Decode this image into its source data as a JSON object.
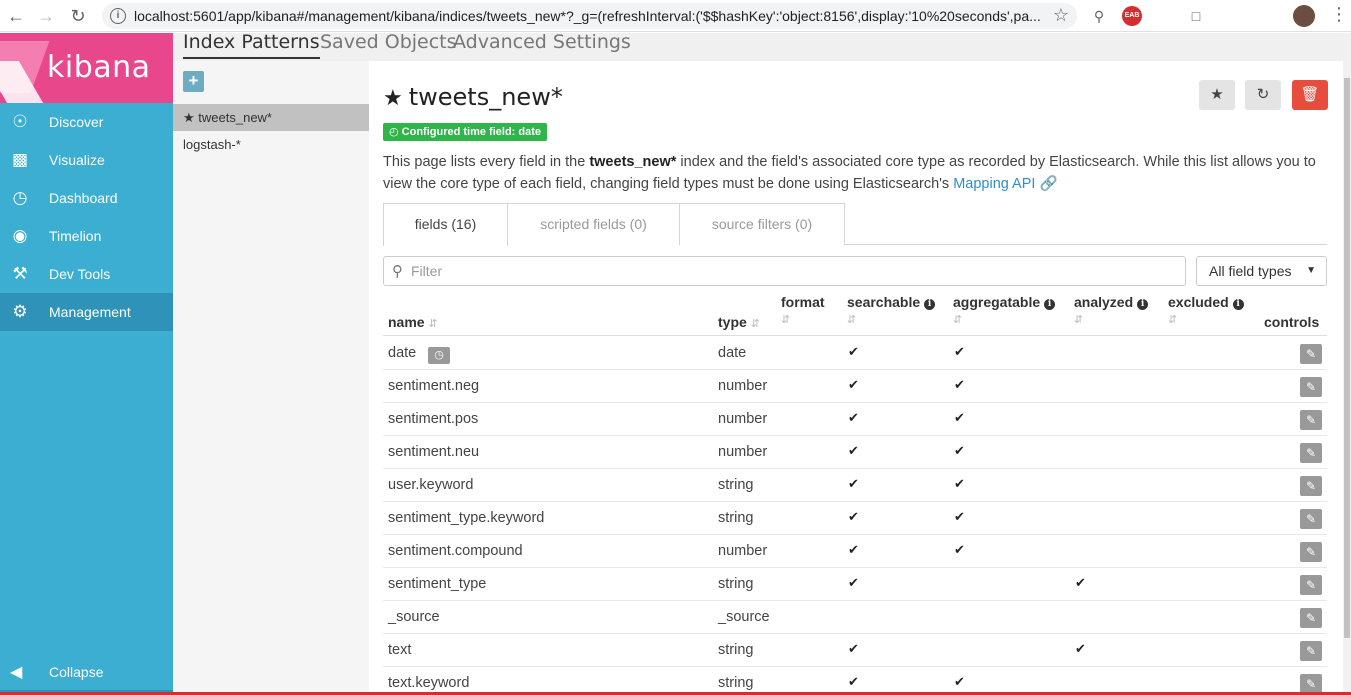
{
  "browser": {
    "url": "localhost:5601/app/kibana#/management/kibana/indices/tweets_new*?_g=(refreshInterval:('$$hashKey':'object:8156',display:'10%20seconds',pa...",
    "back_icon": "arrow-left",
    "forward_icon": "arrow-right",
    "reload_icon": "reload",
    "ext_badge": "EAB"
  },
  "sidebar": {
    "logo": "kibana",
    "items": [
      {
        "label": "Discover",
        "icon": "compass"
      },
      {
        "label": "Visualize",
        "icon": "bar-chart"
      },
      {
        "label": "Dashboard",
        "icon": "gauge"
      },
      {
        "label": "Timelion",
        "icon": "bear"
      },
      {
        "label": "Dev Tools",
        "icon": "wrench"
      },
      {
        "label": "Management",
        "icon": "gear"
      }
    ],
    "active": "Management",
    "collapse_label": "Collapse"
  },
  "topnav": {
    "tabs": [
      "Index Patterns",
      "Saved Objects",
      "Advanced Settings"
    ],
    "active": "Index Patterns"
  },
  "patterns": {
    "add_label": "+",
    "items": [
      "tweets_new*",
      "logstash-*"
    ],
    "selected": "tweets_new*"
  },
  "main": {
    "title": "tweets_new*",
    "time_badge": "Configured time field: date",
    "desc_1": "This page lists every field in the ",
    "desc_index": "tweets_new*",
    "desc_2": " index and the field's associated core type as recorded by Elasticsearch. While this list allows you to view the core type of each field, changing field types must be done using Elasticsearch's ",
    "desc_link": "Mapping API",
    "tabs": [
      "fields (16)",
      "scripted fields (0)",
      "source filters (0)"
    ],
    "filter_placeholder": "Filter",
    "type_select": "All field types"
  },
  "table": {
    "headers": {
      "name": "name",
      "type": "type",
      "format": "format",
      "searchable": "searchable",
      "aggregatable": "aggregatable",
      "analyzed": "analyzed",
      "excluded": "excluded",
      "controls": "controls"
    },
    "rows": [
      {
        "name": "date",
        "type": "date",
        "searchable": true,
        "aggregatable": true,
        "analyzed": false,
        "time": true
      },
      {
        "name": "sentiment.neg",
        "type": "number",
        "searchable": true,
        "aggregatable": true,
        "analyzed": false
      },
      {
        "name": "sentiment.pos",
        "type": "number",
        "searchable": true,
        "aggregatable": true,
        "analyzed": false
      },
      {
        "name": "sentiment.neu",
        "type": "number",
        "searchable": true,
        "aggregatable": true,
        "analyzed": false
      },
      {
        "name": "user.keyword",
        "type": "string",
        "searchable": true,
        "aggregatable": true,
        "analyzed": false
      },
      {
        "name": "sentiment_type.keyword",
        "type": "string",
        "searchable": true,
        "aggregatable": true,
        "analyzed": false
      },
      {
        "name": "sentiment.compound",
        "type": "number",
        "searchable": true,
        "aggregatable": true,
        "analyzed": false
      },
      {
        "name": "sentiment_type",
        "type": "string",
        "searchable": true,
        "aggregatable": false,
        "analyzed": true
      },
      {
        "name": "_source",
        "type": "_source",
        "searchable": false,
        "aggregatable": false,
        "analyzed": false
      },
      {
        "name": "text",
        "type": "string",
        "searchable": true,
        "aggregatable": false,
        "analyzed": true
      },
      {
        "name": "text.keyword",
        "type": "string",
        "searchable": true,
        "aggregatable": true,
        "analyzed": false
      }
    ]
  },
  "colors": {
    "sidebar": "#3caed2",
    "sidebar_active": "#2f93b9",
    "logo_bg": "#e8488b",
    "badge_green": "#2fb54a",
    "danger": "#e74c3c",
    "link": "#328ec6"
  }
}
